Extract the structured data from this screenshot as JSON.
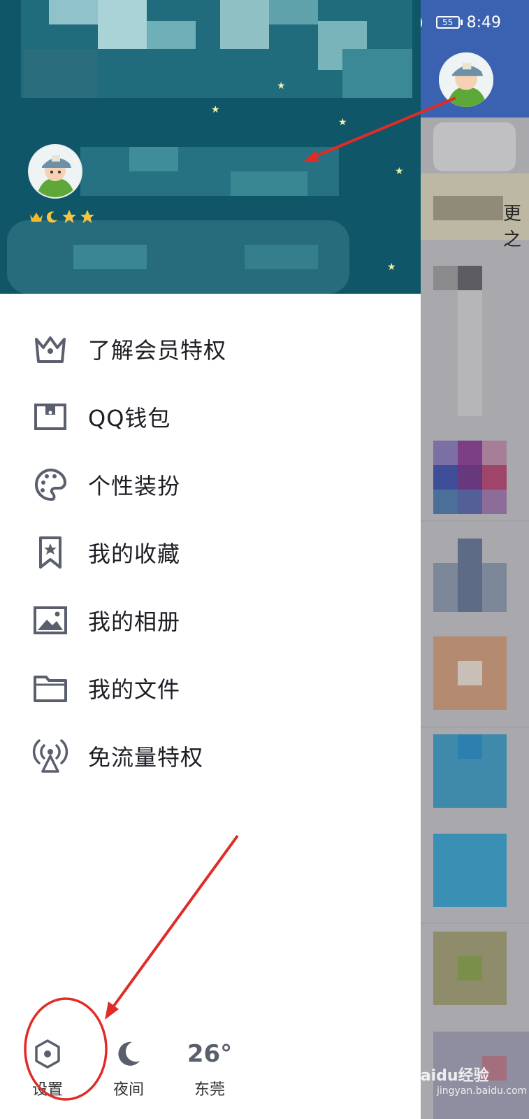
{
  "status_bar": {
    "battery": "55",
    "time": "8:49"
  },
  "menu": [
    {
      "label": "了解会员特权",
      "icon": "crown-icon"
    },
    {
      "label": "QQ钱包",
      "icon": "wallet-icon"
    },
    {
      "label": "个性装扮",
      "icon": "palette-icon"
    },
    {
      "label": "我的收藏",
      "icon": "bookmark-star-icon"
    },
    {
      "label": "我的相册",
      "icon": "image-icon"
    },
    {
      "label": "我的文件",
      "icon": "folder-icon"
    },
    {
      "label": "免流量特权",
      "icon": "signal-tower-icon"
    }
  ],
  "bottom_bar": {
    "settings_label": "设置",
    "night_label": "夜间",
    "weather_temp": "26°",
    "weather_city": "东莞"
  },
  "right_panel": {
    "partial_text": "更之"
  },
  "watermark": {
    "brand": "Baidu经验",
    "url": "jingyan.baidu.com"
  },
  "colors": {
    "header_bg": "#0e5668",
    "icon_color": "#5a5f6e",
    "annotation_red": "#e02b27",
    "right_topbar": "#3b62b0"
  }
}
